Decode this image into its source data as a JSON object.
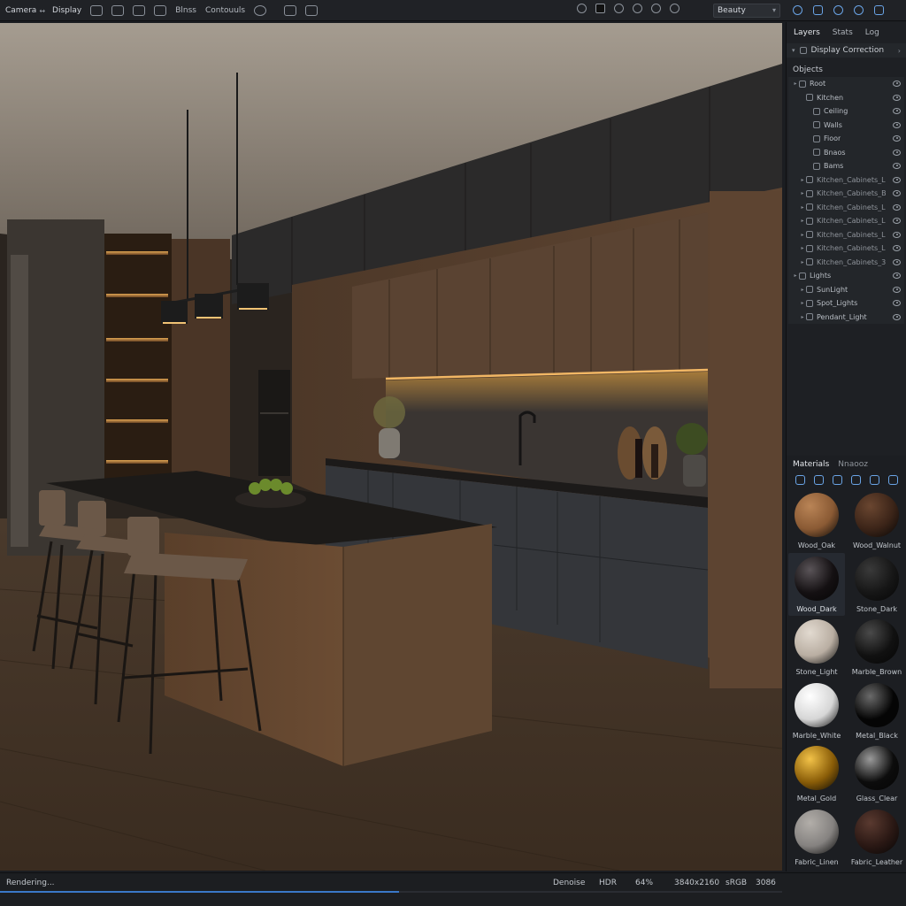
{
  "toolbar": {
    "camera_label": "Camera",
    "display_label": "Display",
    "item3": "Blnss",
    "item4": "Contouuls",
    "render_pass": "Beauty"
  },
  "right_panel": {
    "tabs": [
      "Layers",
      "Stats",
      "Log"
    ],
    "active_tab": "Layers",
    "display_correction": "Display Correction",
    "objects_header": "Objects",
    "tree": [
      {
        "label": "Root",
        "indent": 0,
        "chev": true
      },
      {
        "label": "Kitchen",
        "indent": 1,
        "chev": false
      },
      {
        "label": "Ceiling",
        "indent": 2,
        "chev": false
      },
      {
        "label": "Walls",
        "indent": 2,
        "chev": false
      },
      {
        "label": "Fioor",
        "indent": 2,
        "chev": false
      },
      {
        "label": "Bnaos",
        "indent": 2,
        "chev": false
      },
      {
        "label": "Bams",
        "indent": 2,
        "chev": false
      },
      {
        "label": "Kitchen_Cabinets_L",
        "indent": 1,
        "chev": true
      },
      {
        "label": "Kitchen_Cabinets_B",
        "indent": 1,
        "chev": true
      },
      {
        "label": "Kitchen_Cabinets_L",
        "indent": 1,
        "chev": true
      },
      {
        "label": "Kitchen_Cabinets_L",
        "indent": 1,
        "chev": true
      },
      {
        "label": "Kitchen_Cabinets_L",
        "indent": 1,
        "chev": true
      },
      {
        "label": "Kitchen_Cabinets_L",
        "indent": 1,
        "chev": true
      },
      {
        "label": "Kitchen_Cabinets_3",
        "indent": 1,
        "chev": true
      },
      {
        "label": "Lights",
        "indent": 0,
        "chev": true
      },
      {
        "label": "SunLight",
        "indent": 1,
        "chev": true
      },
      {
        "label": "Spot_Lights",
        "indent": 1,
        "chev": true
      },
      {
        "label": "Pendant_Light",
        "indent": 1,
        "chev": true
      }
    ],
    "materials_tabs": [
      "Materials",
      "Nnaooz"
    ],
    "materials": [
      {
        "name": "Wood_Oak",
        "color": "#8a5a34",
        "highlight": "#b98456"
      },
      {
        "name": "Wood_Walnut",
        "color": "#3b2418",
        "highlight": "#6a4630"
      },
      {
        "name": "Wood_Dark",
        "color": "#141012",
        "highlight": "#5a5458",
        "selected": true
      },
      {
        "name": "Stone_Dark",
        "color": "#161616",
        "highlight": "#3a3a3a"
      },
      {
        "name": "Stone_Light",
        "color": "#b9aea2",
        "highlight": "#e2dad0"
      },
      {
        "name": "Marble_Brown",
        "color": "#111111",
        "highlight": "#4a4a4a"
      },
      {
        "name": "Marble_White",
        "color": "#d6d6d6",
        "highlight": "#ffffff"
      },
      {
        "name": "Metal_Black",
        "color": "#050505",
        "highlight": "#6a6a6a"
      },
      {
        "name": "Metal_Gold",
        "color": "#8a5d08",
        "highlight": "#f2c248"
      },
      {
        "name": "Glass_Clear",
        "color": "#0c0c0c",
        "highlight": "#9a9a9a"
      },
      {
        "name": "Fabric_Linen",
        "color": "#858280",
        "highlight": "#b2aea9"
      },
      {
        "name": "Fabric_Leather",
        "color": "#2a1814",
        "highlight": "#5a3a30"
      }
    ]
  },
  "status": {
    "left": "Rendering...",
    "denoise": "Denoise",
    "hdr": "HDR",
    "progress_text": "64%",
    "progress": 0.51,
    "resolution": "3840x2160",
    "colorspace": "sRGB",
    "last": "3086"
  }
}
